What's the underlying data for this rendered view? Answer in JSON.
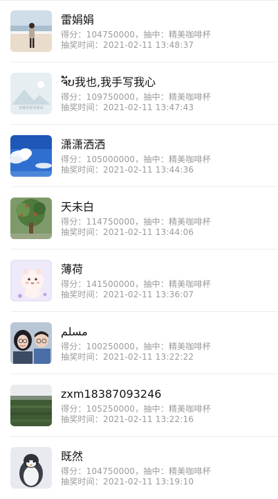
{
  "labels": {
    "score_prefix": "得分：",
    "prize_prefix": "，抽中：",
    "time_prefix": "抽奖时间："
  },
  "entries": [
    {
      "name": "雷娟娟",
      "score": "104750000",
      "prize": "精美咖啡杯",
      "time": "2021-02-11 13:48:37",
      "avatar": "beach-photo-avatar"
    },
    {
      "name": "ຈັບ我也,我手写我心",
      "score": "109750000",
      "prize": "精美咖啡杯",
      "time": "2021-02-11 13:47:43",
      "avatar": "placeholder-landscape-avatar",
      "avatar_caption": "加载失败请重试"
    },
    {
      "name": "潇潇洒洒",
      "score": "105000000",
      "prize": "精美咖啡杯",
      "time": "2021-02-11 13:44:36",
      "avatar": "blue-sky-avatar"
    },
    {
      "name": "天未白",
      "score": "114750000",
      "prize": "精美咖啡杯",
      "time": "2021-02-11 13:44:06",
      "avatar": "tree-avatar"
    },
    {
      "name": "薄荷",
      "score": "141500000",
      "prize": "精美咖啡杯",
      "time": "2021-02-11 13:36:07",
      "avatar": "cartoon-pig-avatar"
    },
    {
      "name": "مسلم",
      "score": "100250000",
      "prize": "精美咖啡杯",
      "time": "2021-02-11 13:22:22",
      "avatar": "two-people-avatar"
    },
    {
      "name": "zxm18387093246",
      "score": "105250000",
      "prize": "精美咖啡杯",
      "time": "2021-02-11 13:22:16",
      "avatar": "field-avatar"
    },
    {
      "name": "既然",
      "score": "104750000",
      "prize": "精美咖啡杯",
      "time": "2021-02-11 13:19:10",
      "avatar": "penguin-avatar"
    }
  ]
}
